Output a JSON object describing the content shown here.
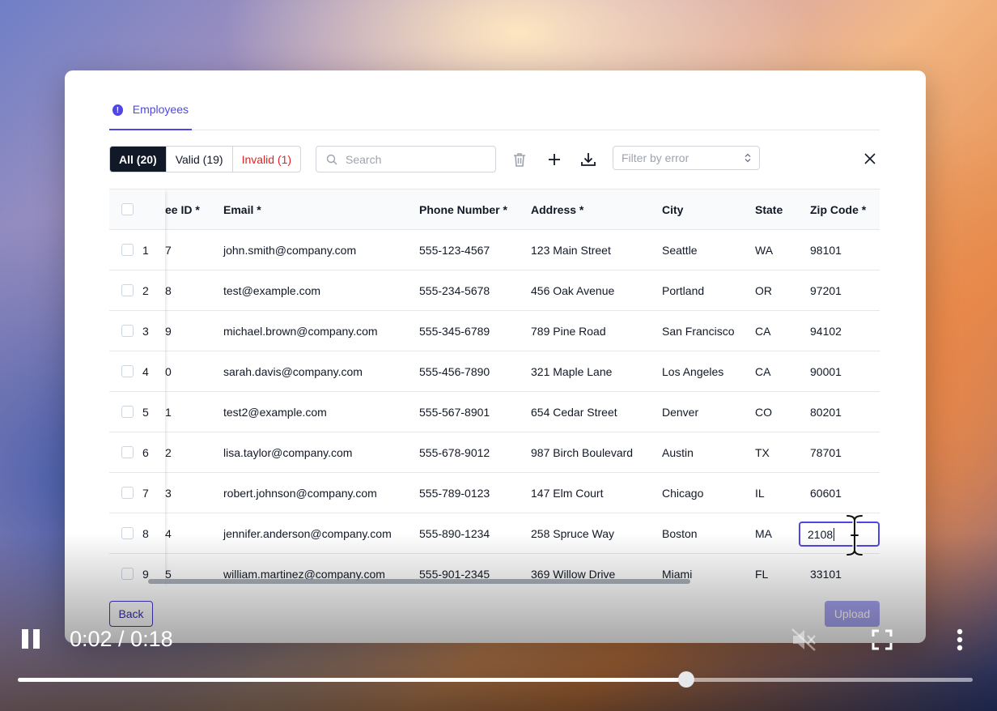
{
  "tab": {
    "label": "Employees",
    "icon": "alert-circle-icon"
  },
  "filters": {
    "all": "All (20)",
    "valid": "Valid (19)",
    "invalid": "Invalid (1)"
  },
  "search": {
    "placeholder": "Search",
    "value": ""
  },
  "toolbar_icons": [
    "trash-icon",
    "plus-icon",
    "download-icon"
  ],
  "error_filter": {
    "placeholder": "Filter by error"
  },
  "table": {
    "columns": [
      "ee ID *",
      "Email *",
      "Phone Number *",
      "Address *",
      "City",
      "State",
      "Zip Code *"
    ],
    "rows": [
      {
        "num": "1",
        "id": "7",
        "email": "john.smith@company.com",
        "phone": "555-123-4567",
        "address": "123 Main Street",
        "city": "Seattle",
        "state": "WA",
        "zip": "98101"
      },
      {
        "num": "2",
        "id": "8",
        "email": "test@example.com",
        "phone": "555-234-5678",
        "address": "456 Oak Avenue",
        "city": "Portland",
        "state": "OR",
        "zip": "97201"
      },
      {
        "num": "3",
        "id": "9",
        "email": "michael.brown@company.com",
        "phone": "555-345-6789",
        "address": "789 Pine Road",
        "city": "San Francisco",
        "state": "CA",
        "zip": "94102"
      },
      {
        "num": "4",
        "id": "0",
        "email": "sarah.davis@company.com",
        "phone": "555-456-7890",
        "address": "321 Maple Lane",
        "city": "Los Angeles",
        "state": "CA",
        "zip": "90001"
      },
      {
        "num": "5",
        "id": "1",
        "email": "test2@example.com",
        "phone": "555-567-8901",
        "address": "654 Cedar Street",
        "city": "Denver",
        "state": "CO",
        "zip": "80201"
      },
      {
        "num": "6",
        "id": "2",
        "email": "lisa.taylor@company.com",
        "phone": "555-678-9012",
        "address": "987 Birch Boulevard",
        "city": "Austin",
        "state": "TX",
        "zip": "78701"
      },
      {
        "num": "7",
        "id": "3",
        "email": "robert.johnson@company.com",
        "phone": "555-789-0123",
        "address": "147 Elm Court",
        "city": "Chicago",
        "state": "IL",
        "zip": "60601"
      },
      {
        "num": "8",
        "id": "4",
        "email": "jennifer.anderson@company.com",
        "phone": "555-890-1234",
        "address": "258 Spruce Way",
        "city": "Boston",
        "state": "MA",
        "zip": "2108"
      },
      {
        "num": "9",
        "id": "5",
        "email": "william.martinez@company.com",
        "phone": "555-901-2345",
        "address": "369 Willow Drive",
        "city": "Miami",
        "state": "FL",
        "zip": "33101"
      }
    ]
  },
  "buttons": {
    "back": "Back",
    "upload": "Upload"
  },
  "player": {
    "time": "0:02 / 0:18",
    "progress": 0.7,
    "icons": [
      "pause-icon",
      "muted-speaker-icon",
      "fullscreen-icon",
      "more-vertical-icon"
    ]
  },
  "colors": {
    "accent": "#4f46e5",
    "invalid": "#dc2626",
    "active_segment": "#111827"
  }
}
